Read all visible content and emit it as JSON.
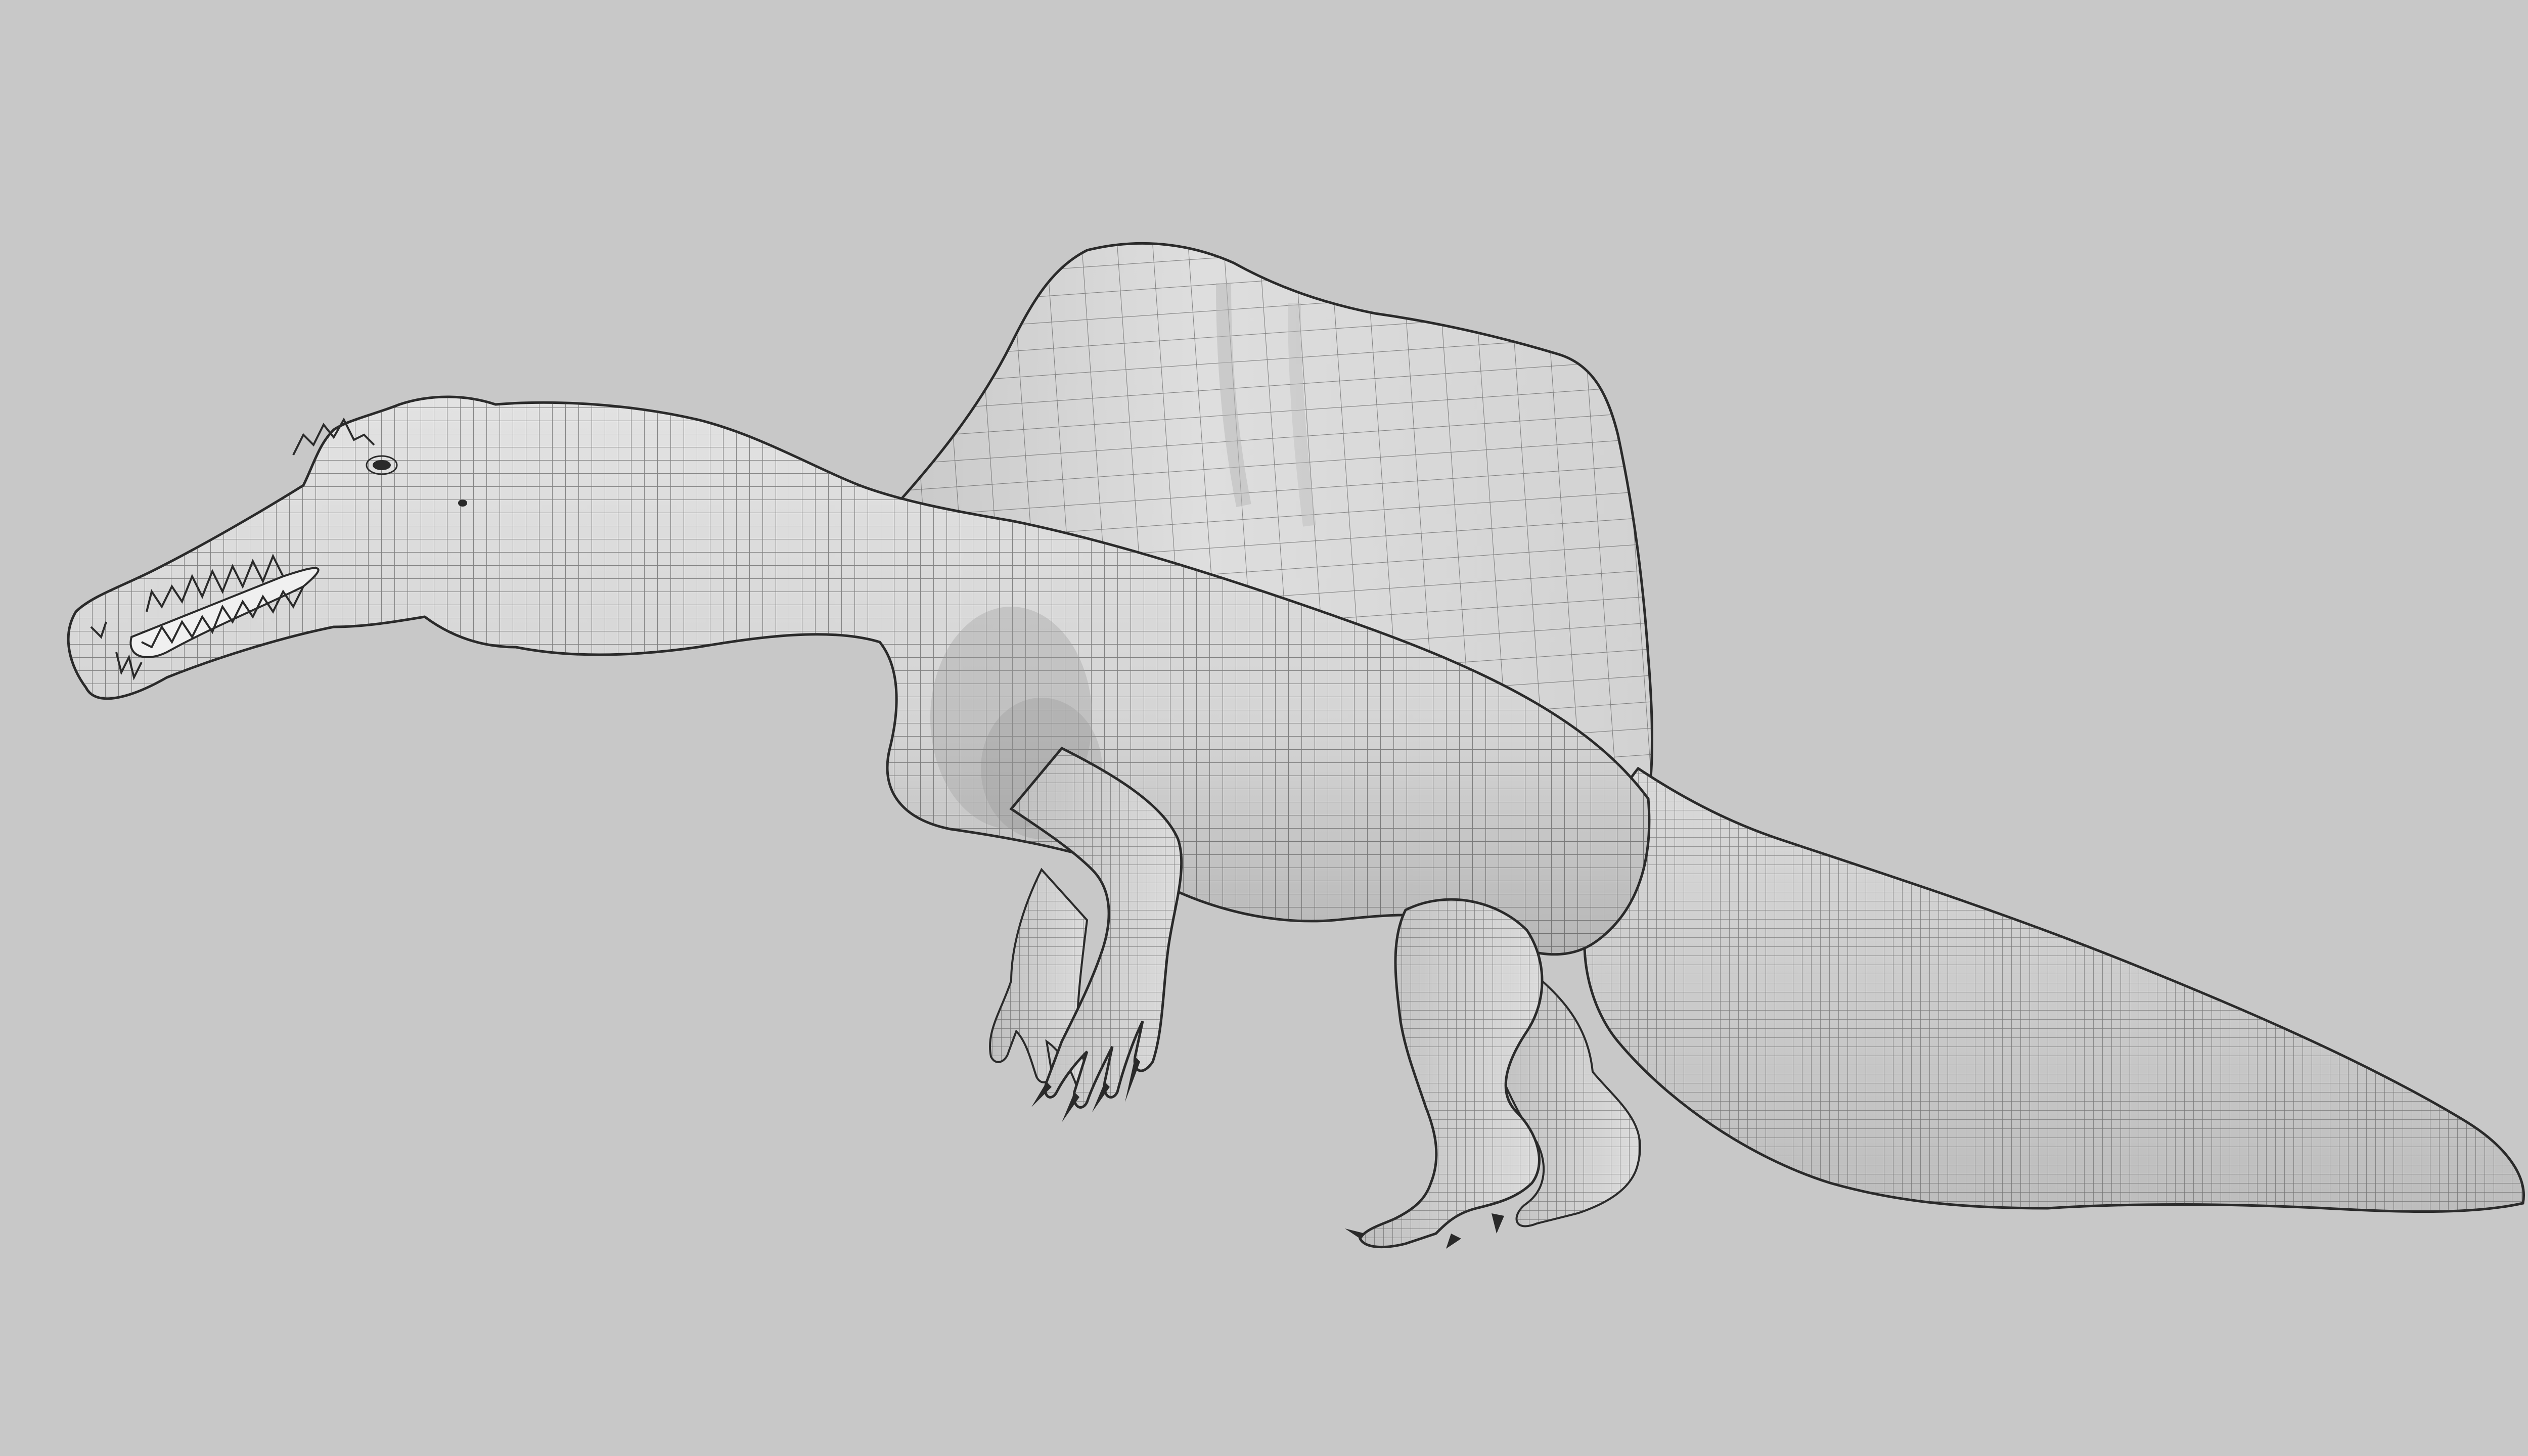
{
  "viewport": {
    "background_color": "#c8c8c8",
    "display_mode": "wireframe-on-shaded"
  },
  "model": {
    "subject": "spinosaurus",
    "surface_color": "#dcdcdc",
    "shade_color": "#a9a9a9",
    "wire_color": "#3a3a3a",
    "outline_color": "#2a2a2a",
    "interior_color": "#f0f0f0"
  }
}
